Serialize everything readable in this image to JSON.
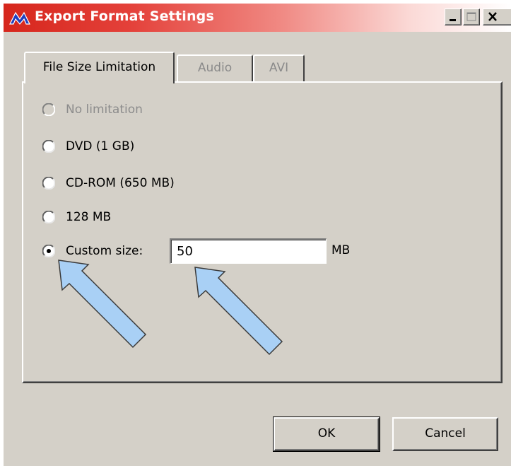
{
  "window": {
    "title": "Export Format Settings",
    "controls": [
      "minimize-icon",
      "maximize-icon",
      "close-icon"
    ]
  },
  "tabs": [
    {
      "label": "File Size Limitation",
      "active": true,
      "enabled": true
    },
    {
      "label": "Audio",
      "active": false,
      "enabled": false
    },
    {
      "label": "AVI",
      "active": false,
      "enabled": false
    }
  ],
  "options": [
    {
      "label": "No limitation",
      "selected": false,
      "enabled": false
    },
    {
      "label": "DVD (1 GB)",
      "selected": false,
      "enabled": true
    },
    {
      "label": "CD-ROM (650 MB)",
      "selected": false,
      "enabled": true
    },
    {
      "label": "128 MB",
      "selected": false,
      "enabled": true
    },
    {
      "label": "Custom size:",
      "selected": true,
      "enabled": true
    }
  ],
  "custom_size": {
    "value": "50",
    "unit": "MB"
  },
  "buttons": {
    "ok": "OK",
    "cancel": "Cancel"
  },
  "colors": {
    "titlebar_start": "#d6261c",
    "face": "#d4d0c8",
    "annotation_arrow": "#a9d0f5",
    "disabled_text": "#8c8c8c"
  },
  "annotations": [
    "arrow-icon",
    "arrow-icon"
  ]
}
